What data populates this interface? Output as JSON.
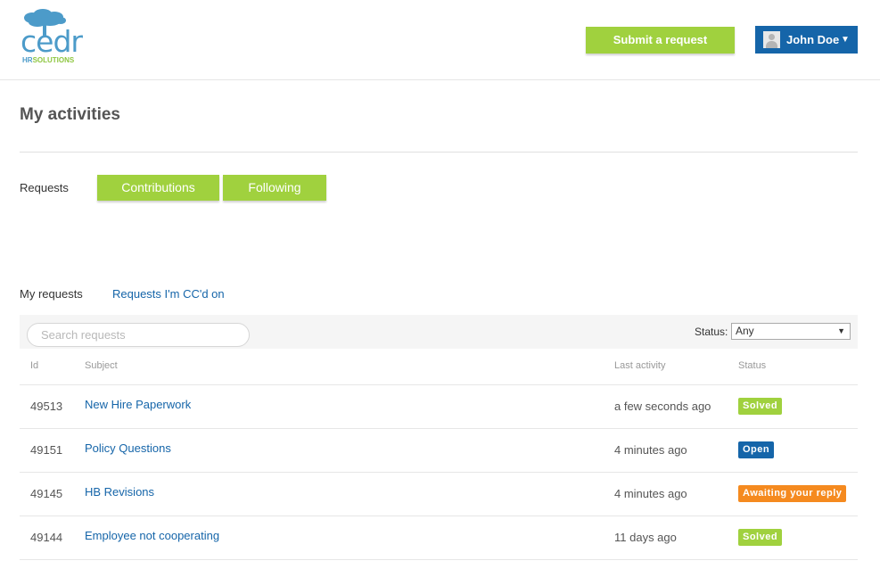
{
  "logo": {
    "word": "cedr",
    "sub_hr": "HR",
    "sub_rest": "SOLUTIONS"
  },
  "header": {
    "submit_label": "Submit a request",
    "user_name": "John Doe",
    "caret": "▼"
  },
  "page": {
    "title": "My activities"
  },
  "activity_tabs": {
    "requests_label": "Requests",
    "contributions_label": "Contributions",
    "following_label": "Following"
  },
  "request_tabs": {
    "mine": "My requests",
    "cc": "Requests I'm CC'd on"
  },
  "toolbar": {
    "search_placeholder": "Search requests",
    "status_label": "Status:",
    "status_value": "Any",
    "status_arrow": "▼"
  },
  "table": {
    "headers": {
      "id": "Id",
      "subject": "Subject",
      "last_activity": "Last activity",
      "status": "Status"
    },
    "rows": [
      {
        "id": "49513",
        "subject": "New Hire Paperwork",
        "last_activity": "a few seconds ago",
        "status": "Solved"
      },
      {
        "id": "49151",
        "subject": "Policy Questions",
        "last_activity": "4 minutes ago",
        "status": "Open"
      },
      {
        "id": "49145",
        "subject": "HB Revisions",
        "last_activity": "4 minutes ago",
        "status": "Awaiting your reply"
      },
      {
        "id": "49144",
        "subject": "Employee not cooperating",
        "last_activity": "11 days ago",
        "status": "Solved"
      }
    ]
  },
  "colors": {
    "green": "#a0d13e",
    "blue": "#1565a9",
    "orange": "#f58a1f",
    "logo_blue": "#4c9bc9"
  }
}
